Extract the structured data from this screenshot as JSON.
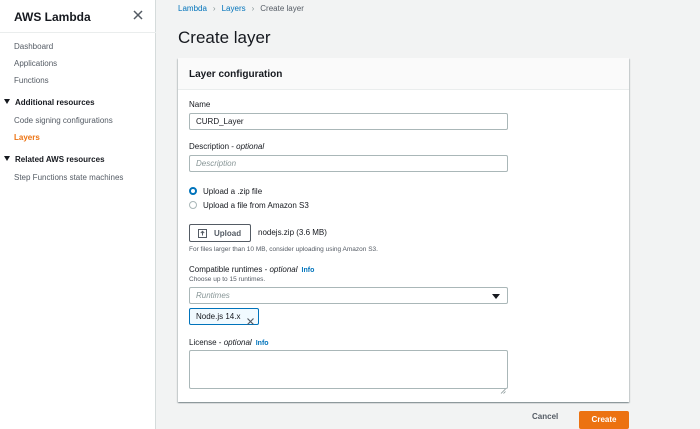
{
  "sidebar": {
    "title": "AWS Lambda",
    "links": [
      "Dashboard",
      "Applications",
      "Functions"
    ],
    "sections": [
      {
        "label": "Additional resources",
        "items": [
          "Code signing configurations",
          "Layers"
        ]
      },
      {
        "label": "Related AWS resources",
        "items": [
          "Step Functions state machines"
        ]
      }
    ],
    "active_item": "Layers"
  },
  "breadcrumb": {
    "items": [
      "Lambda",
      "Layers"
    ],
    "current": "Create layer"
  },
  "page_title": "Create layer",
  "panel": {
    "title": "Layer configuration",
    "name": {
      "label": "Name",
      "value": "CURD_Layer"
    },
    "description": {
      "label": "Description",
      "optional": "optional",
      "placeholder": "Description"
    },
    "upload_options": [
      {
        "label": "Upload a .zip file",
        "selected": true
      },
      {
        "label": "Upload a file from Amazon S3",
        "selected": false
      }
    ],
    "upload": {
      "button_label": "Upload",
      "file_name": "nodejs.zip (3.6 MB)",
      "hint": "For files larger than 10 MB, consider uploading using Amazon S3."
    },
    "runtimes": {
      "label": "Compatible runtimes",
      "optional": "optional",
      "info": "Info",
      "hint": "Choose up to 15 runtimes.",
      "placeholder": "Runtimes",
      "selected_token": "Node.js 14.x"
    },
    "license": {
      "label": "License",
      "optional": "optional",
      "info": "Info",
      "value": ""
    }
  },
  "footer": {
    "cancel_label": "Cancel",
    "create_label": "Create"
  },
  "colors": {
    "accent": "#ec7211",
    "link": "#0073bb",
    "background": "#f2f3f3"
  },
  "icons": {
    "close": "close-icon",
    "upload": "upload-icon",
    "dropdown": "caret-down-icon",
    "token_remove": "remove-token-icon"
  }
}
